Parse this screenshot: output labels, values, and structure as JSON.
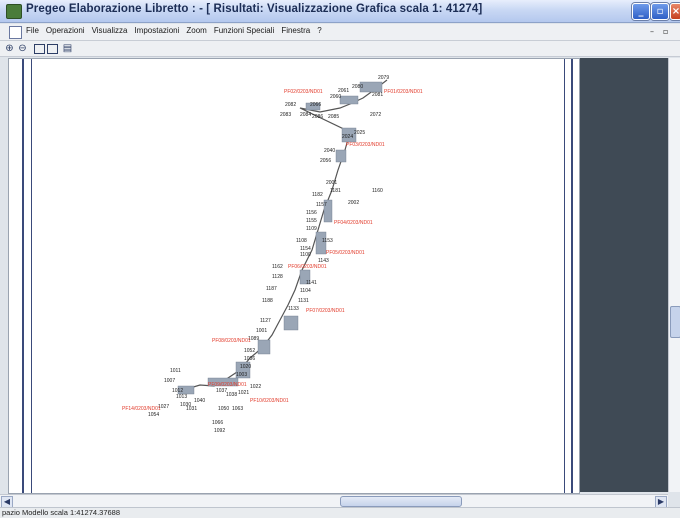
{
  "window": {
    "title": "Pregeo Elaborazione Libretto : - [ Risultati: Visualizzazione Grafica scala 1: 41274]"
  },
  "menu": {
    "items": [
      "File",
      "Operazioni",
      "Visualizza",
      "Impostazioni",
      "Zoom",
      "Funzioni Speciali",
      "Finestra",
      "?"
    ]
  },
  "toolbar": {
    "icons": [
      "zoom-in-icon",
      "zoom-out-icon",
      "single-page-icon",
      "two-pages-icon",
      "print-icon"
    ]
  },
  "status": {
    "text": "pazio Modello scala 1:41274.37688"
  },
  "map": {
    "red_labels": [
      "PF01/0203/ND01",
      "PF02/0203/ND01",
      "PF03/0203/ND01",
      "PF04/0203/ND01",
      "PF05/0203/ND01",
      "PF06/0203/ND01",
      "PF07/0203/ND01",
      "PF08/0203/ND01",
      "PF09/0203/ND01",
      "PF10/0203/ND01",
      "PF14/0203/ND01"
    ],
    "point_labels": [
      "2079",
      "2080",
      "2061",
      "2081",
      "2060",
      "2082",
      "2083",
      "2084",
      "2086",
      "2085",
      "2066",
      "2072",
      "2024",
      "2025",
      "2040",
      "2056",
      "2001",
      "1181",
      "1182",
      "1160",
      "2002",
      "1157",
      "1156",
      "1155",
      "1109",
      "1108",
      "1154",
      "1153",
      "1143",
      "1100",
      "1162",
      "1128",
      "1141",
      "1104",
      "1187",
      "1188",
      "1131",
      "1127",
      "1133",
      "1001",
      "1089",
      "1052",
      "1036",
      "1020",
      "1003",
      "1022",
      "1021",
      "1011",
      "1007",
      "1012",
      "1013",
      "1040",
      "1037",
      "1038",
      "1030",
      "1031",
      "1027",
      "1054",
      "1050",
      "1063",
      "1066",
      "1092"
    ]
  }
}
